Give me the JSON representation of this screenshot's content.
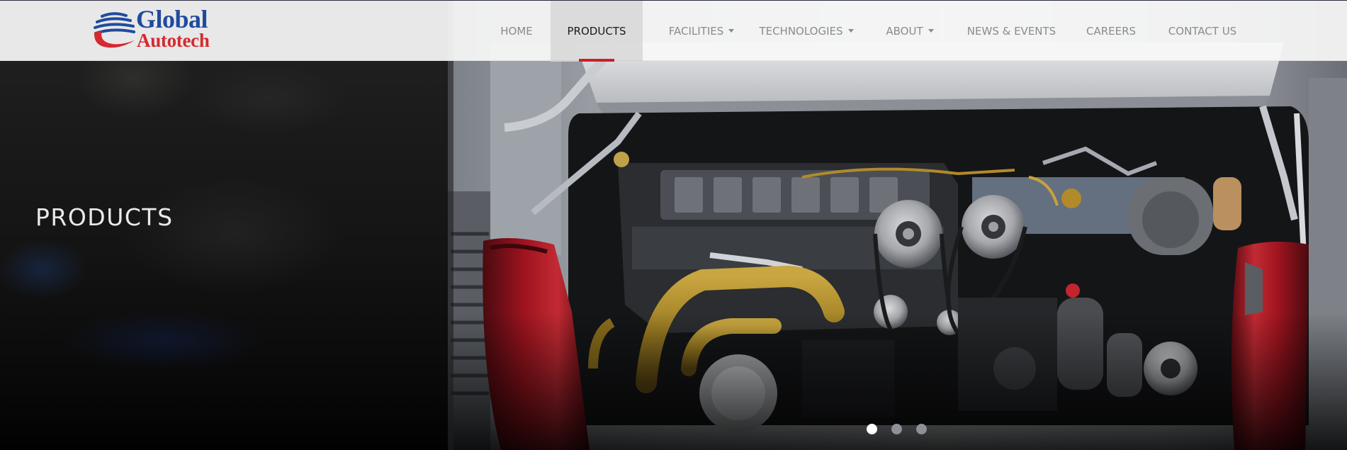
{
  "brand": {
    "word1": "Global",
    "word2": "Autotech",
    "blue": "#1f4b9e",
    "red": "#d42a30"
  },
  "nav": {
    "items": [
      {
        "label": "HOME",
        "dropdown": false,
        "active": false
      },
      {
        "label": "PRODUCTS",
        "dropdown": false,
        "active": true
      },
      {
        "label": "FACILITIES",
        "dropdown": true,
        "active": false
      },
      {
        "label": "TECHNOLOGIES",
        "dropdown": true,
        "active": false
      },
      {
        "label": "ABOUT",
        "dropdown": true,
        "active": false
      },
      {
        "label": "NEWS & EVENTS",
        "dropdown": false,
        "active": false
      },
      {
        "label": "CAREERS",
        "dropdown": false,
        "active": false
      },
      {
        "label": "CONTACT US",
        "dropdown": false,
        "active": false
      }
    ],
    "accent": "#d21f2a"
  },
  "hero": {
    "title": "PRODUCTS",
    "image": "bus-engine-compartment"
  },
  "slider": {
    "count": 3,
    "active_index": 0
  }
}
